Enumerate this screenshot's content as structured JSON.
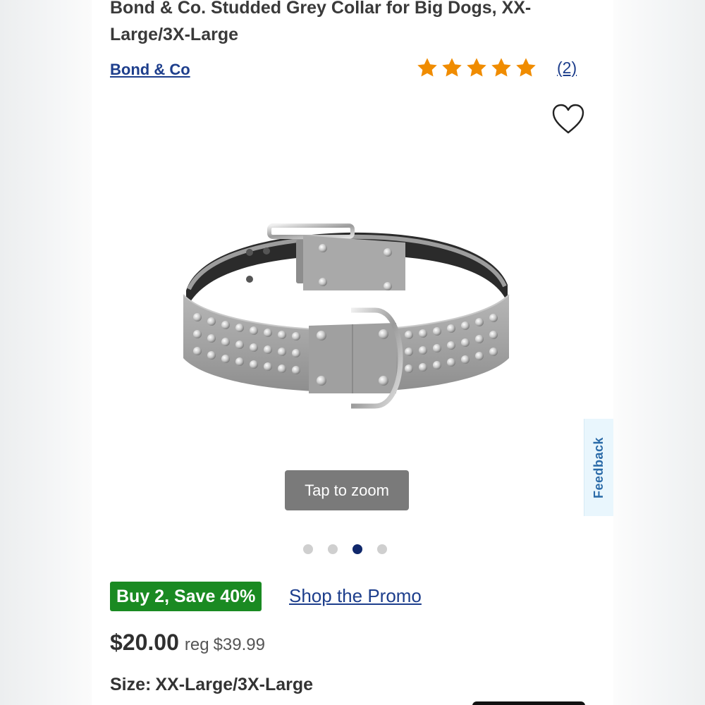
{
  "product": {
    "title": "Bond & Co. Studded Grey Collar for Big Dogs, XX-Large/3X-Large",
    "brand": "Bond & Co",
    "rating": 5,
    "review_count": "(2)",
    "star_color": "#f08c00"
  },
  "gallery": {
    "zoom_label": "Tap to zoom",
    "slide_count": 4,
    "active_slide": 3,
    "image": "studded-grey-dog-collar"
  },
  "feedback": {
    "label": "Feedback"
  },
  "promo": {
    "badge": "Buy 2, Save 40%",
    "link": "Shop the Promo",
    "badge_color": "#1a8a22"
  },
  "pricing": {
    "price": "$20.00",
    "reg_label": "reg",
    "reg_price": "$39.99"
  },
  "size": {
    "label": "Size:",
    "value": "XX-Large/3X-Large"
  },
  "icons": {
    "wishlist": "heart-outline-icon",
    "rating": "star-icon"
  }
}
